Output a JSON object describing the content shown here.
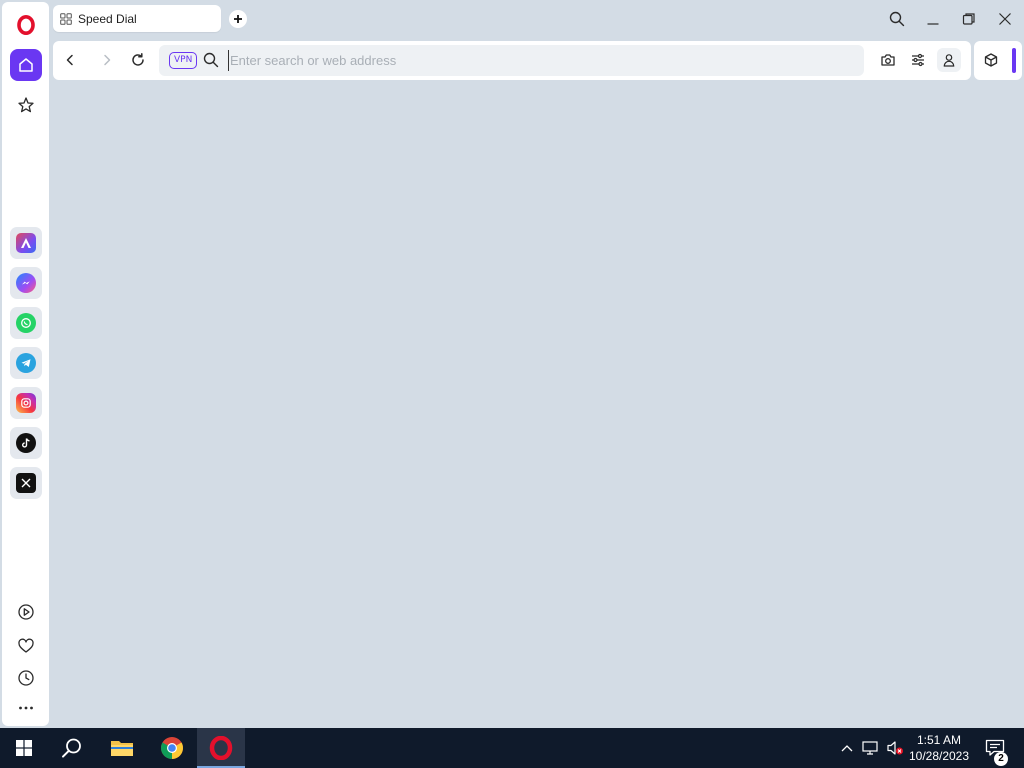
{
  "tab": {
    "title": "Speed Dial"
  },
  "toolbar": {
    "vpn_label": "VPN",
    "address_placeholder": "Enter search or web address"
  },
  "sidebar": {
    "apps": [
      "Aria",
      "Messenger",
      "WhatsApp",
      "Telegram",
      "Instagram",
      "TikTok",
      "X"
    ],
    "bottom": [
      "player-icon",
      "heart-icon",
      "history-icon",
      "more-icon"
    ]
  },
  "taskbar": {
    "time": "1:51 AM",
    "date": "10/28/2023",
    "notification_count": "2"
  },
  "colors": {
    "accent": "#6a37f2",
    "background": "#d3dce5",
    "taskbar": "#0f1a2b"
  }
}
